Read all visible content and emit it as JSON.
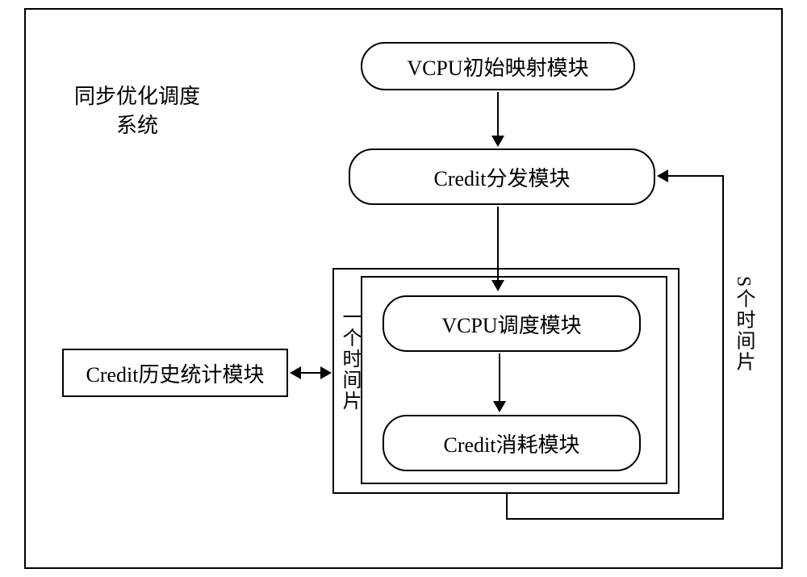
{
  "title_line1": "同步优化调度",
  "title_line2": "系统",
  "box_vcpu_init": "VCPU初始映射模块",
  "box_credit_dist": "Credit分发模块",
  "box_vcpu_sched": "VCPU调度模块",
  "box_credit_consume": "Credit消耗模块",
  "box_credit_history": "Credit历史统计模块",
  "label_one_slice": "一个时间片",
  "label_s_slices": "S个时间片"
}
